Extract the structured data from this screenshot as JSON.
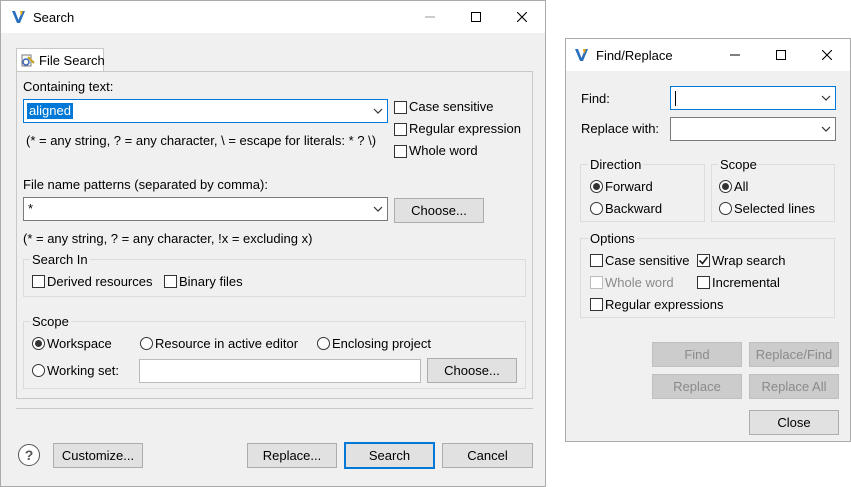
{
  "search": {
    "title": "Search",
    "tab": "File Search",
    "containing_text_label": "Containing text:",
    "containing_text_value": "aligned",
    "literal_hint": "(* = any string, ? = any character, \\ = escape for literals: * ? \\)",
    "case_sensitive": "Case sensitive",
    "regular_expression": "Regular expression",
    "whole_word": "Whole word",
    "file_patterns_label": "File name patterns (separated by comma):",
    "file_patterns_value": "*",
    "choose_1": "Choose...",
    "pattern_hint": "(* = any string, ? = any character, !x = excluding x)",
    "search_in": "Search In",
    "derived_resources": "Derived resources",
    "binary_files": "Binary files",
    "scope": "Scope",
    "workspace": "Workspace",
    "resource_active_editor": "Resource in active editor",
    "enclosing_project": "Enclosing project",
    "working_set": "Working set:",
    "working_set_value": "",
    "choose_2": "Choose...",
    "customize": "Customize...",
    "replace": "Replace...",
    "search_button": "Search",
    "cancel": "Cancel",
    "help_glyph": "?"
  },
  "find": {
    "title": "Find/Replace",
    "find_label": "Find:",
    "find_value": "",
    "replace_with_label": "Replace with:",
    "replace_with_value": "",
    "direction": "Direction",
    "forward": "Forward",
    "backward": "Backward",
    "scope": "Scope",
    "all": "All",
    "selected_lines": "Selected lines",
    "options": "Options",
    "case_sensitive": "Case sensitive",
    "wrap_search": "Wrap search",
    "whole_word": "Whole word",
    "incremental": "Incremental",
    "regular_expressions": "Regular expressions",
    "find_button": "Find",
    "replace_find": "Replace/Find",
    "replace_button": "Replace",
    "replace_all": "Replace All",
    "close": "Close"
  },
  "colors": {
    "accent": "#0078d7",
    "selection": "#0078d7",
    "window_bg": "#f0f0f0"
  }
}
